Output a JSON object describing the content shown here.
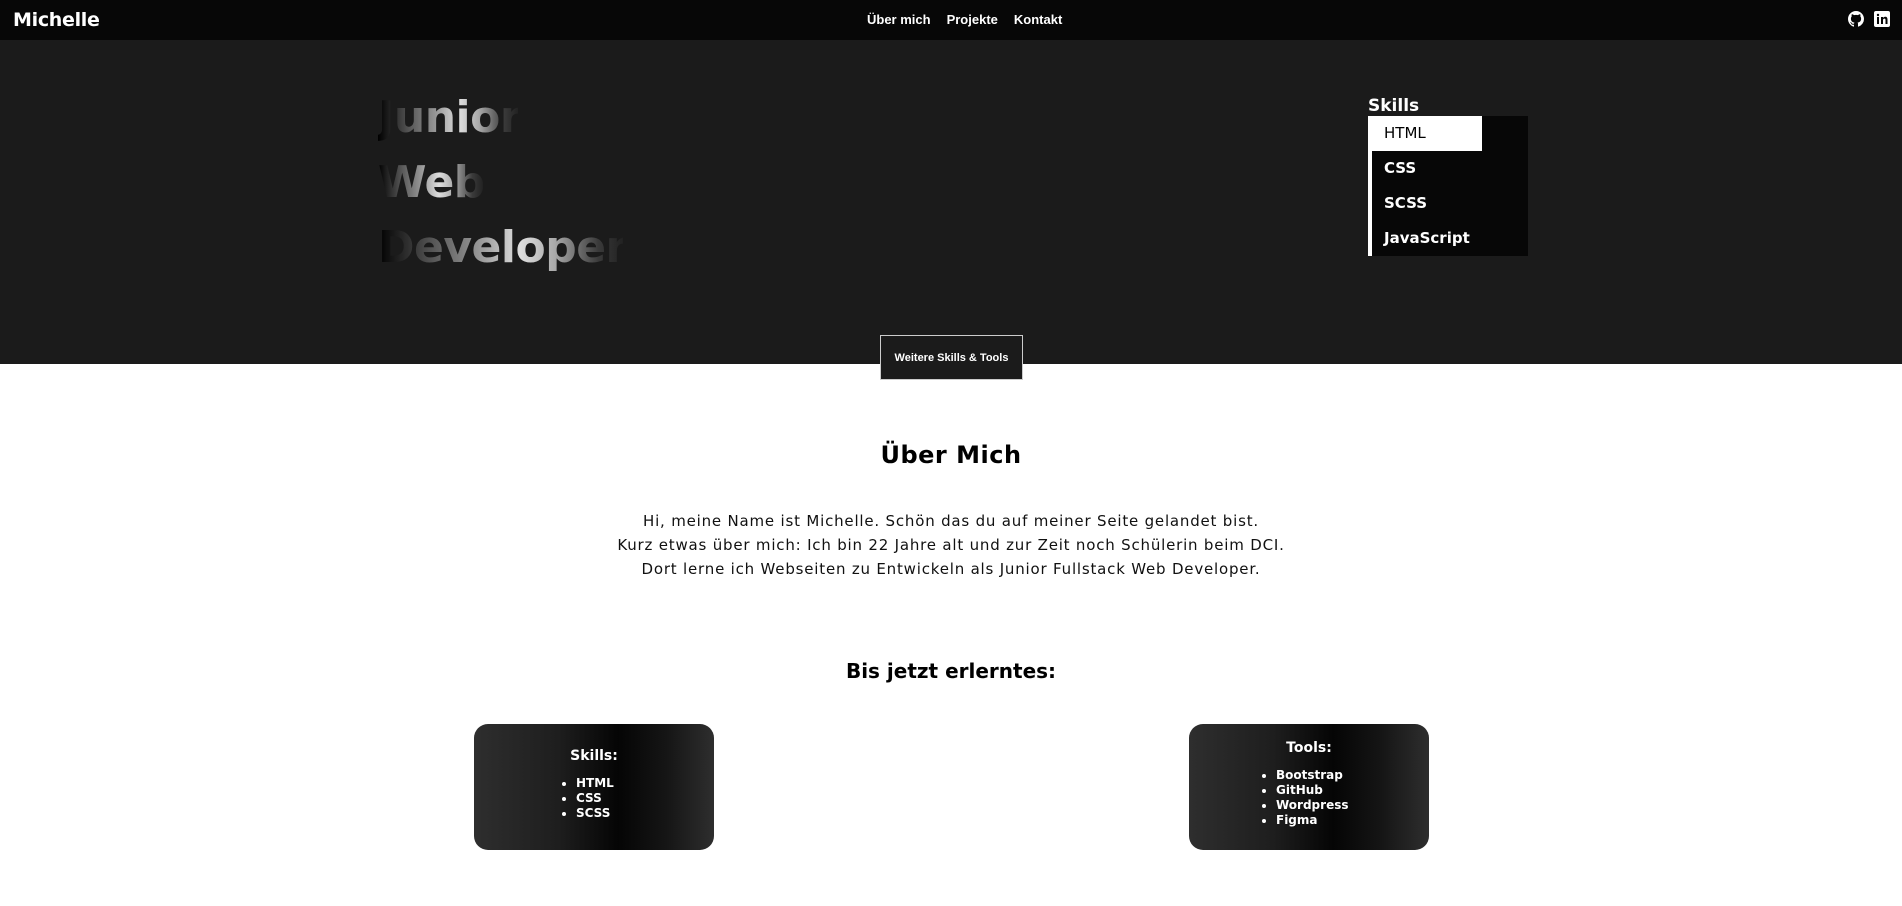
{
  "navbar": {
    "brand": "Michelle",
    "links": [
      "Über mich",
      "Projekte",
      "Kontakt"
    ],
    "social_icons": [
      "github-icon",
      "linkedin-icon"
    ]
  },
  "hero": {
    "title_lines": [
      "Junior",
      "Web",
      "Developer"
    ],
    "skills": {
      "heading": "Skills",
      "items": [
        "HTML",
        "CSS",
        "SCSS",
        "JavaScript"
      ],
      "active": "HTML"
    },
    "more_button": "Weitere Skills & Tools"
  },
  "about": {
    "title": "Über Mich",
    "paragraph_lines": [
      "Hi, meine Name ist Michelle. Schön das du auf meiner Seite gelandet bist.",
      "Kurz etwas über mich: Ich bin 22 Jahre alt und zur Zeit noch Schülerin beim DCI.",
      "Dort lerne ich Webseiten zu Entwickeln als Junior Fullstack Web Developer."
    ]
  },
  "learned": {
    "title": "Bis jetzt erlerntes:",
    "skills_card": {
      "title": "Skills:",
      "items": [
        "HTML",
        "CSS",
        "SCSS"
      ]
    },
    "tools_card": {
      "title": "Tools:",
      "items": [
        "Bootstrap",
        "GitHub",
        "Wordpress",
        "Figma"
      ]
    }
  },
  "colors": {
    "nav_bg": "#070707",
    "hero_bg": "#1b1b1b",
    "page_bg": "#ffffff",
    "text": "#000000"
  }
}
